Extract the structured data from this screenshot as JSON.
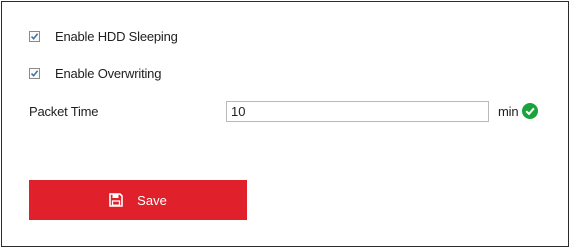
{
  "settings": {
    "enable_hdd_sleeping": {
      "label": "Enable HDD Sleeping",
      "checked": true
    },
    "enable_overwriting": {
      "label": "Enable Overwriting",
      "checked": true
    },
    "packet_time": {
      "label": "Packet Time",
      "value": "10",
      "unit": "min",
      "valid_icon": "check-circle-icon"
    }
  },
  "actions": {
    "save_label": "Save",
    "save_icon": "save-floppy-icon"
  },
  "colors": {
    "accent": "#e0202a",
    "valid": "#1aa33a",
    "checkbox_check": "#4a6f9c"
  }
}
